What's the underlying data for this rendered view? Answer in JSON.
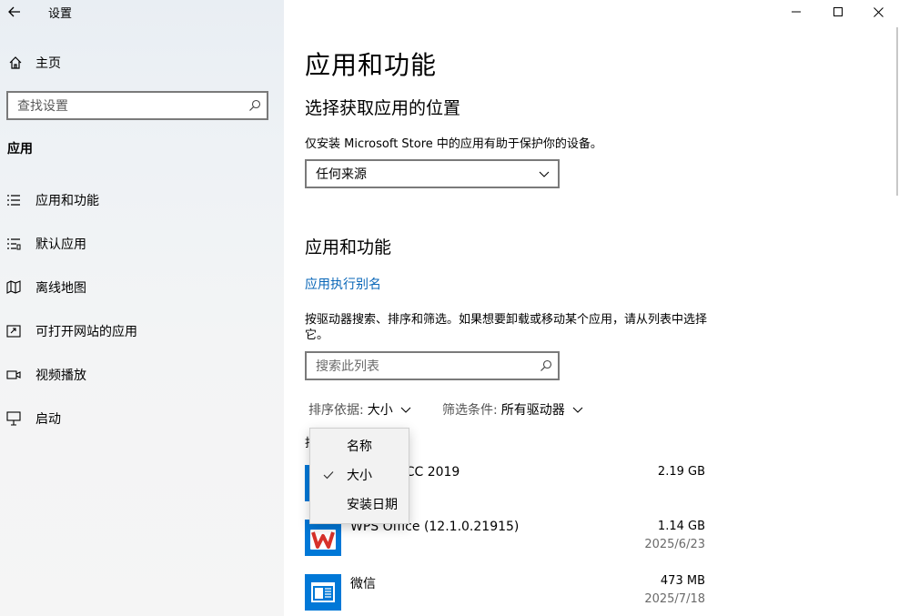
{
  "window": {
    "title": "设置"
  },
  "sidebar": {
    "home_label": "主页",
    "search_placeholder": "查找设置",
    "section_label": "应用",
    "items": [
      {
        "label": "应用和功能",
        "icon": "list-icon"
      },
      {
        "label": "默认应用",
        "icon": "default-apps-icon"
      },
      {
        "label": "离线地图",
        "icon": "map-icon"
      },
      {
        "label": "可打开网站的应用",
        "icon": "open-in-window-icon"
      },
      {
        "label": "视频播放",
        "icon": "video-icon"
      },
      {
        "label": "启动",
        "icon": "startup-icon"
      }
    ]
  },
  "main": {
    "page_title": "应用和功能",
    "source_heading": "选择获取应用的位置",
    "source_desc": "仅安装 Microsoft Store 中的应用有助于保护你的设备。",
    "source_value": "任何来源",
    "apps_heading": "应用和功能",
    "alias_link": "应用执行别名",
    "search_desc": "按驱动器搜索、排序和筛选。如果想要卸载或移动某个应用，请从列表中选择它。",
    "list_search_placeholder": "搜索此列表",
    "sort_key": "排序依据:",
    "sort_value": "大小",
    "filter_key": "筛选条件:",
    "filter_value": "所有驱动器",
    "count_stub": "找",
    "apps": [
      {
        "name": "Adobe Photoshop CC 2019",
        "visible_name": "otoshop CC 2019",
        "size": "2.19 GB",
        "date": ""
      },
      {
        "name": "WPS Office (12.1.0.21915)",
        "visible_name": "WPS Office (12.1.0.21915)",
        "size": "1.14 GB",
        "date": "2025/6/23"
      },
      {
        "name": "微信",
        "visible_name": "微信",
        "size": "473 MB",
        "date": "2025/7/18"
      }
    ]
  },
  "sort_menu": {
    "options": [
      "名称",
      "大小",
      "安装日期"
    ],
    "selected": "大小"
  },
  "colors": {
    "accent": "#0078d7",
    "link": "#0a67b8",
    "wps_red": "#d7312a"
  }
}
